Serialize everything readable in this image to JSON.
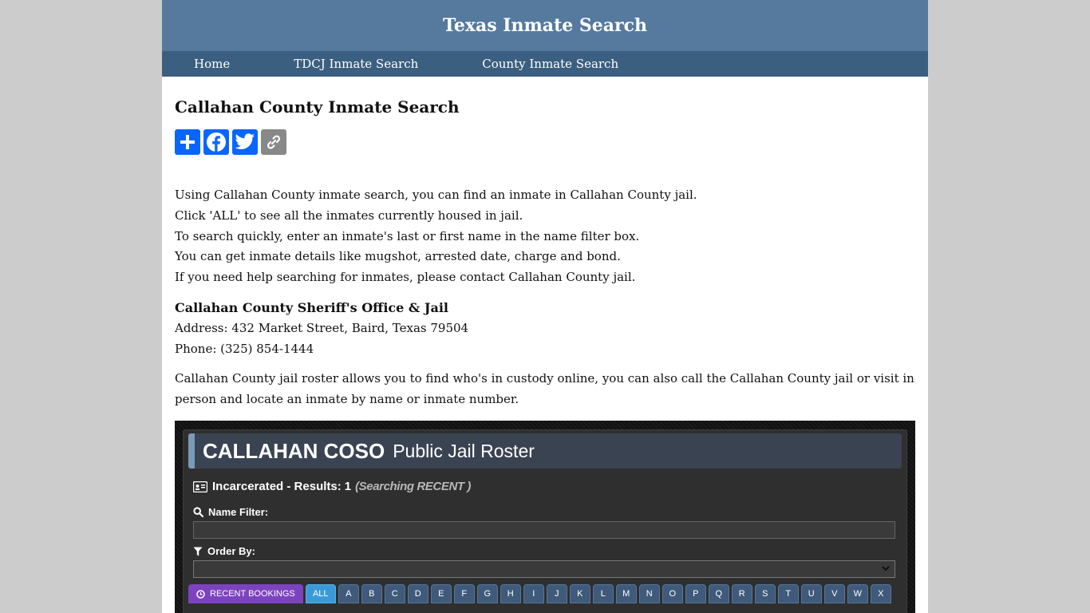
{
  "site": {
    "title": "Texas Inmate Search"
  },
  "nav": [
    {
      "label": "Home"
    },
    {
      "label": "TDCJ Inmate Search"
    },
    {
      "label": "County Inmate Search"
    }
  ],
  "page": {
    "title": "Callahan County Inmate Search",
    "share_buttons": [
      {
        "icon": "share-plus-icon",
        "color": "#0866ff"
      },
      {
        "icon": "facebook-icon",
        "color": "#0866ff"
      },
      {
        "icon": "twitter-icon",
        "color": "#0866ff"
      },
      {
        "icon": "copy-link-icon",
        "color": "#888888"
      }
    ],
    "intro": [
      "Using Callahan County inmate search, you can find an inmate in Callahan County jail.",
      "Click 'ALL' to see all the inmates currently housed in jail.",
      "To search quickly, enter an inmate's last or first name in the name filter box.",
      "You can get inmate details like mugshot, arrested date, charge and bond.",
      "If you need help searching for inmates, please contact Callahan County jail."
    ],
    "contact": {
      "name": "Callahan County Sheriff's Office & Jail",
      "address": "Address: 432 Market Street, Baird, Texas 79504",
      "phone": "Phone: (325) 854-1444"
    },
    "roster_desc": "Callahan County jail roster allows you to find who's in custody online, you can also call the Callahan County jail or visit in person and locate an inmate by name or inmate number."
  },
  "roster": {
    "agency": "CALLAHAN COSO",
    "title": "Public Jail Roster",
    "status_label": "Incarcerated - Results:",
    "count": "1",
    "searching": "(Searching RECENT )",
    "name_filter_label": "Name Filter:",
    "name_filter_value": "",
    "order_by_label": "Order By:",
    "order_by_value": "",
    "recent_button": "RECENT BOOKINGS",
    "all_button": "ALL",
    "letters": [
      "A",
      "B",
      "C",
      "D",
      "E",
      "F",
      "G",
      "H",
      "I",
      "J",
      "K",
      "L",
      "M",
      "N",
      "O",
      "P",
      "Q",
      "R",
      "S",
      "T",
      "U",
      "V",
      "W",
      "X"
    ]
  }
}
